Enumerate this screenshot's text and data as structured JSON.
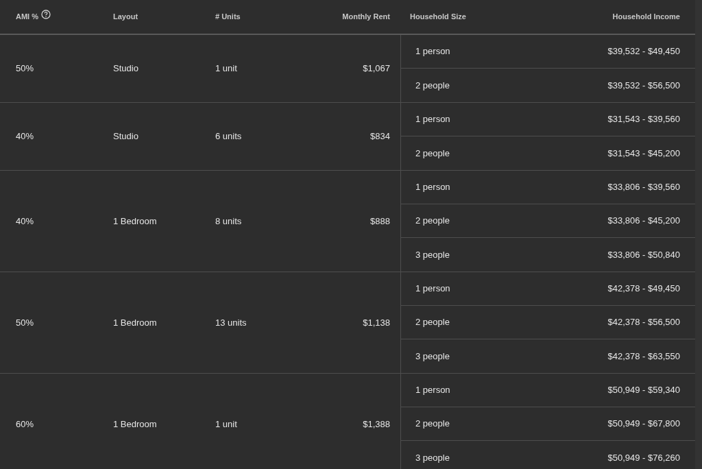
{
  "table": {
    "columns": [
      "AMI %",
      "Layout",
      "# Units",
      "Monthly Rent",
      "Household Size",
      "Household Income"
    ],
    "rows": [
      {
        "ami": "50%",
        "layout": "Studio",
        "units": "1 unit",
        "rent": "$1,067",
        "households": [
          {
            "size": "1 person",
            "income": "$39,532 - $49,450"
          },
          {
            "size": "2 people",
            "income": "$39,532 - $56,500"
          }
        ]
      },
      {
        "ami": "40%",
        "layout": "Studio",
        "units": "6 units",
        "rent": "$834",
        "households": [
          {
            "size": "1 person",
            "income": "$31,543 - $39,560"
          },
          {
            "size": "2 people",
            "income": "$31,543 - $45,200"
          }
        ]
      },
      {
        "ami": "40%",
        "layout": "1 Bedroom",
        "units": "8 units",
        "rent": "$888",
        "households": [
          {
            "size": "1 person",
            "income": "$33,806 - $39,560"
          },
          {
            "size": "2 people",
            "income": "$33,806 - $45,200"
          },
          {
            "size": "3 people",
            "income": "$33,806 - $50,840"
          }
        ]
      },
      {
        "ami": "50%",
        "layout": "1 Bedroom",
        "units": "13 units",
        "rent": "$1,138",
        "households": [
          {
            "size": "1 person",
            "income": "$42,378 - $49,450"
          },
          {
            "size": "2 people",
            "income": "$42,378 - $56,500"
          },
          {
            "size": "3 people",
            "income": "$42,378 - $63,550"
          }
        ]
      },
      {
        "ami": "60%",
        "layout": "1 Bedroom",
        "units": "1 unit",
        "rent": "$1,388",
        "households": [
          {
            "size": "1 person",
            "income": "$50,949 - $59,340"
          },
          {
            "size": "2 people",
            "income": "$50,949 - $67,800"
          },
          {
            "size": "3 people",
            "income": "$50,949 - $76,260"
          }
        ]
      }
    ]
  }
}
